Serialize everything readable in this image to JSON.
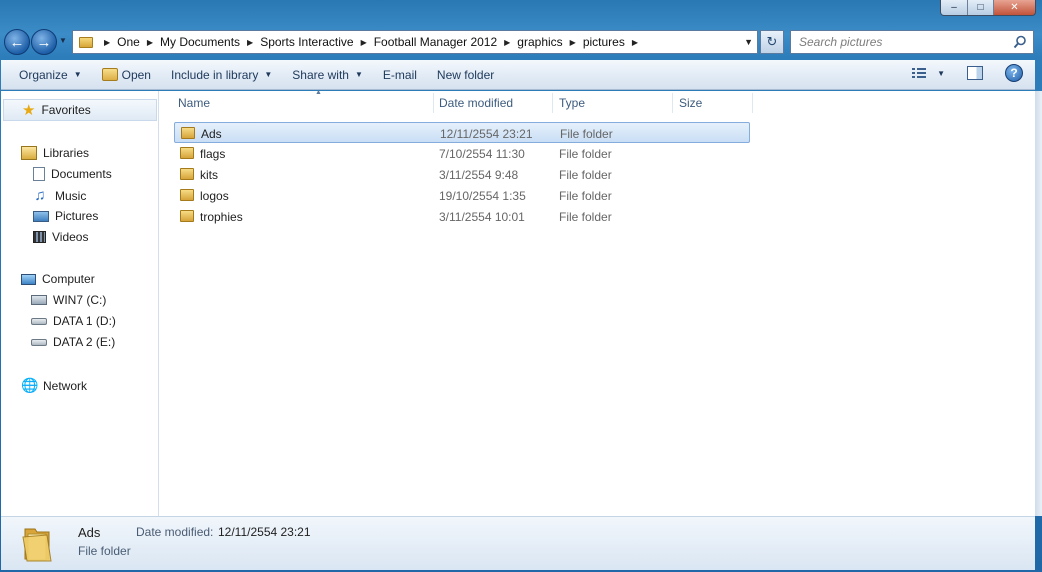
{
  "window": {
    "minimize_glyph": "–",
    "maximize_glyph": "□",
    "close_glyph": "✕"
  },
  "address_bar": {
    "crumbs": [
      "One",
      "My Documents",
      "Sports Interactive",
      "Football Manager 2012",
      "graphics",
      "pictures"
    ],
    "search_placeholder": "Search pictures"
  },
  "toolbar": {
    "organize": "Organize",
    "open": "Open",
    "include_in_library": "Include in library",
    "share_with": "Share with",
    "email": "E-mail",
    "new_folder": "New folder"
  },
  "nav_pane": {
    "favorites": "Favorites",
    "libraries": "Libraries",
    "documents": "Documents",
    "music": "Music",
    "pictures": "Pictures",
    "videos": "Videos",
    "computer": "Computer",
    "drive_c": "WIN7 (C:)",
    "drive_d": "DATA 1 (D:)",
    "drive_e": "DATA 2 (E:)",
    "network": "Network"
  },
  "columns": {
    "name": "Name",
    "date_modified": "Date modified",
    "type": "Type",
    "size": "Size"
  },
  "files": [
    {
      "name": "Ads",
      "date": "12/11/2554 23:21",
      "type": "File folder"
    },
    {
      "name": "flags",
      "date": "7/10/2554 11:30",
      "type": "File folder"
    },
    {
      "name": "kits",
      "date": "3/11/2554 9:48",
      "type": "File folder"
    },
    {
      "name": "logos",
      "date": "19/10/2554 1:35",
      "type": "File folder"
    },
    {
      "name": "trophies",
      "date": "3/11/2554 10:01",
      "type": "File folder"
    }
  ],
  "details": {
    "name": "Ads",
    "type": "File folder",
    "date_label": "Date modified:",
    "date_value": "12/11/2554 23:21"
  },
  "colors": {
    "selection_border": "#84acdd",
    "header_text": "#3e5c7e"
  }
}
